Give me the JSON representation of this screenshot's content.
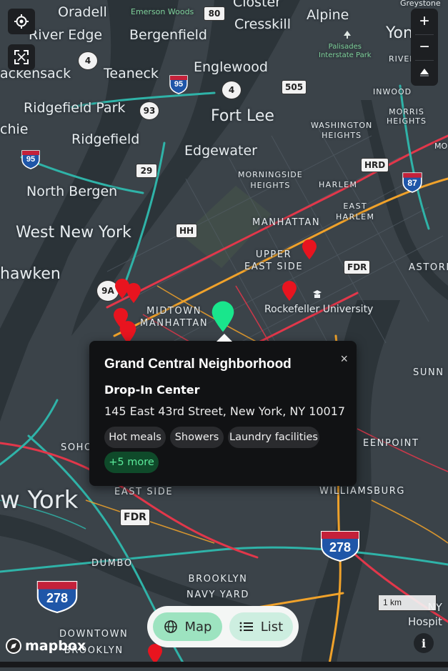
{
  "map": {
    "labels": {
      "oradell": "Oradell",
      "emerson_woods": "Emerson Woods",
      "closter": "Closter",
      "greystone": "Greystone",
      "river_edge": "River Edge",
      "bergenfield": "Bergenfield",
      "cresskill": "Cresskill",
      "alpine": "Alpine",
      "yonkers": "Yon",
      "hackensack": "ackensack",
      "teaneck": "Teaneck",
      "englewood": "Englewood",
      "palisades": "Palisades\nInterstate Park",
      "riverdale": "RIVER",
      "inwood": "INWOOD",
      "ridgefield_park": "Ridgefield Park",
      "fort_lee": "Fort Lee",
      "morris_heights": "MORRIS\nHEIGHTS",
      "washington_heights": "WASHINGTON\nHEIGHTS",
      "secaucus": "chie",
      "ridgefield": "Ridgefield",
      "edgewater": "Edgewater",
      "mo": "MO",
      "morningside": "MORNINGSIDE\nHEIGHTS",
      "harlem": "HARLEM",
      "east_harlem": "EAST\nHARLEM",
      "north_bergen": "North Bergen",
      "west_new_york": "West New York",
      "manhattan": "MANHATTAN",
      "upper_east_side": "UPPER\nEAST SIDE",
      "weehawken": "hawken",
      "astoria": "ASTORI",
      "midtown": "MIDTOWN\nMANHATTAN",
      "rockefeller": "Rockefeller University",
      "sunnyside": "SUNN",
      "soho": "SOHO",
      "greenpoint": "EENPOINT",
      "new_york": "w York",
      "east_side": "EAST SIDE",
      "williamsburg": "WILLIAMSBURG",
      "dumbo": "DUMBO",
      "brooklyn_navy_yard": "BROOKLYN\nNAVY YARD",
      "downtown_brooklyn": "DOWNTOWN\nBROOKLYN",
      "ny_hospital": "NY\nHospit"
    },
    "shields": {
      "r80": "80",
      "r4a": "4",
      "r4b": "4",
      "i95a": "95",
      "r505": "505",
      "r93": "93",
      "i95b": "95",
      "r29": "29",
      "hrd": "HRD",
      "i87": "87",
      "hh": "HH",
      "fdr1": "FDR",
      "r9a": "9A",
      "fdr2": "FDR",
      "i278a": "278",
      "i278b": "278"
    }
  },
  "controls": {
    "zoom_in": "+",
    "zoom_out": "−",
    "scale_label": "1 km",
    "logo_text": "mapbox",
    "info_label": "i"
  },
  "popup": {
    "title": "Grand Central Neighborhood",
    "subtitle": "Drop-In Center",
    "address": "145 East 43rd Street, New York, NY 10017",
    "services": [
      "Hot meals",
      "Showers",
      "Laundry facilities"
    ],
    "more": "+5 more",
    "close": "×"
  },
  "view_toggle": {
    "map_label": "Map",
    "list_label": "List",
    "active": "map"
  },
  "colors": {
    "selected_marker": "#19e68c",
    "marker": "#e8141f",
    "active_toggle": "#9de3c0"
  }
}
